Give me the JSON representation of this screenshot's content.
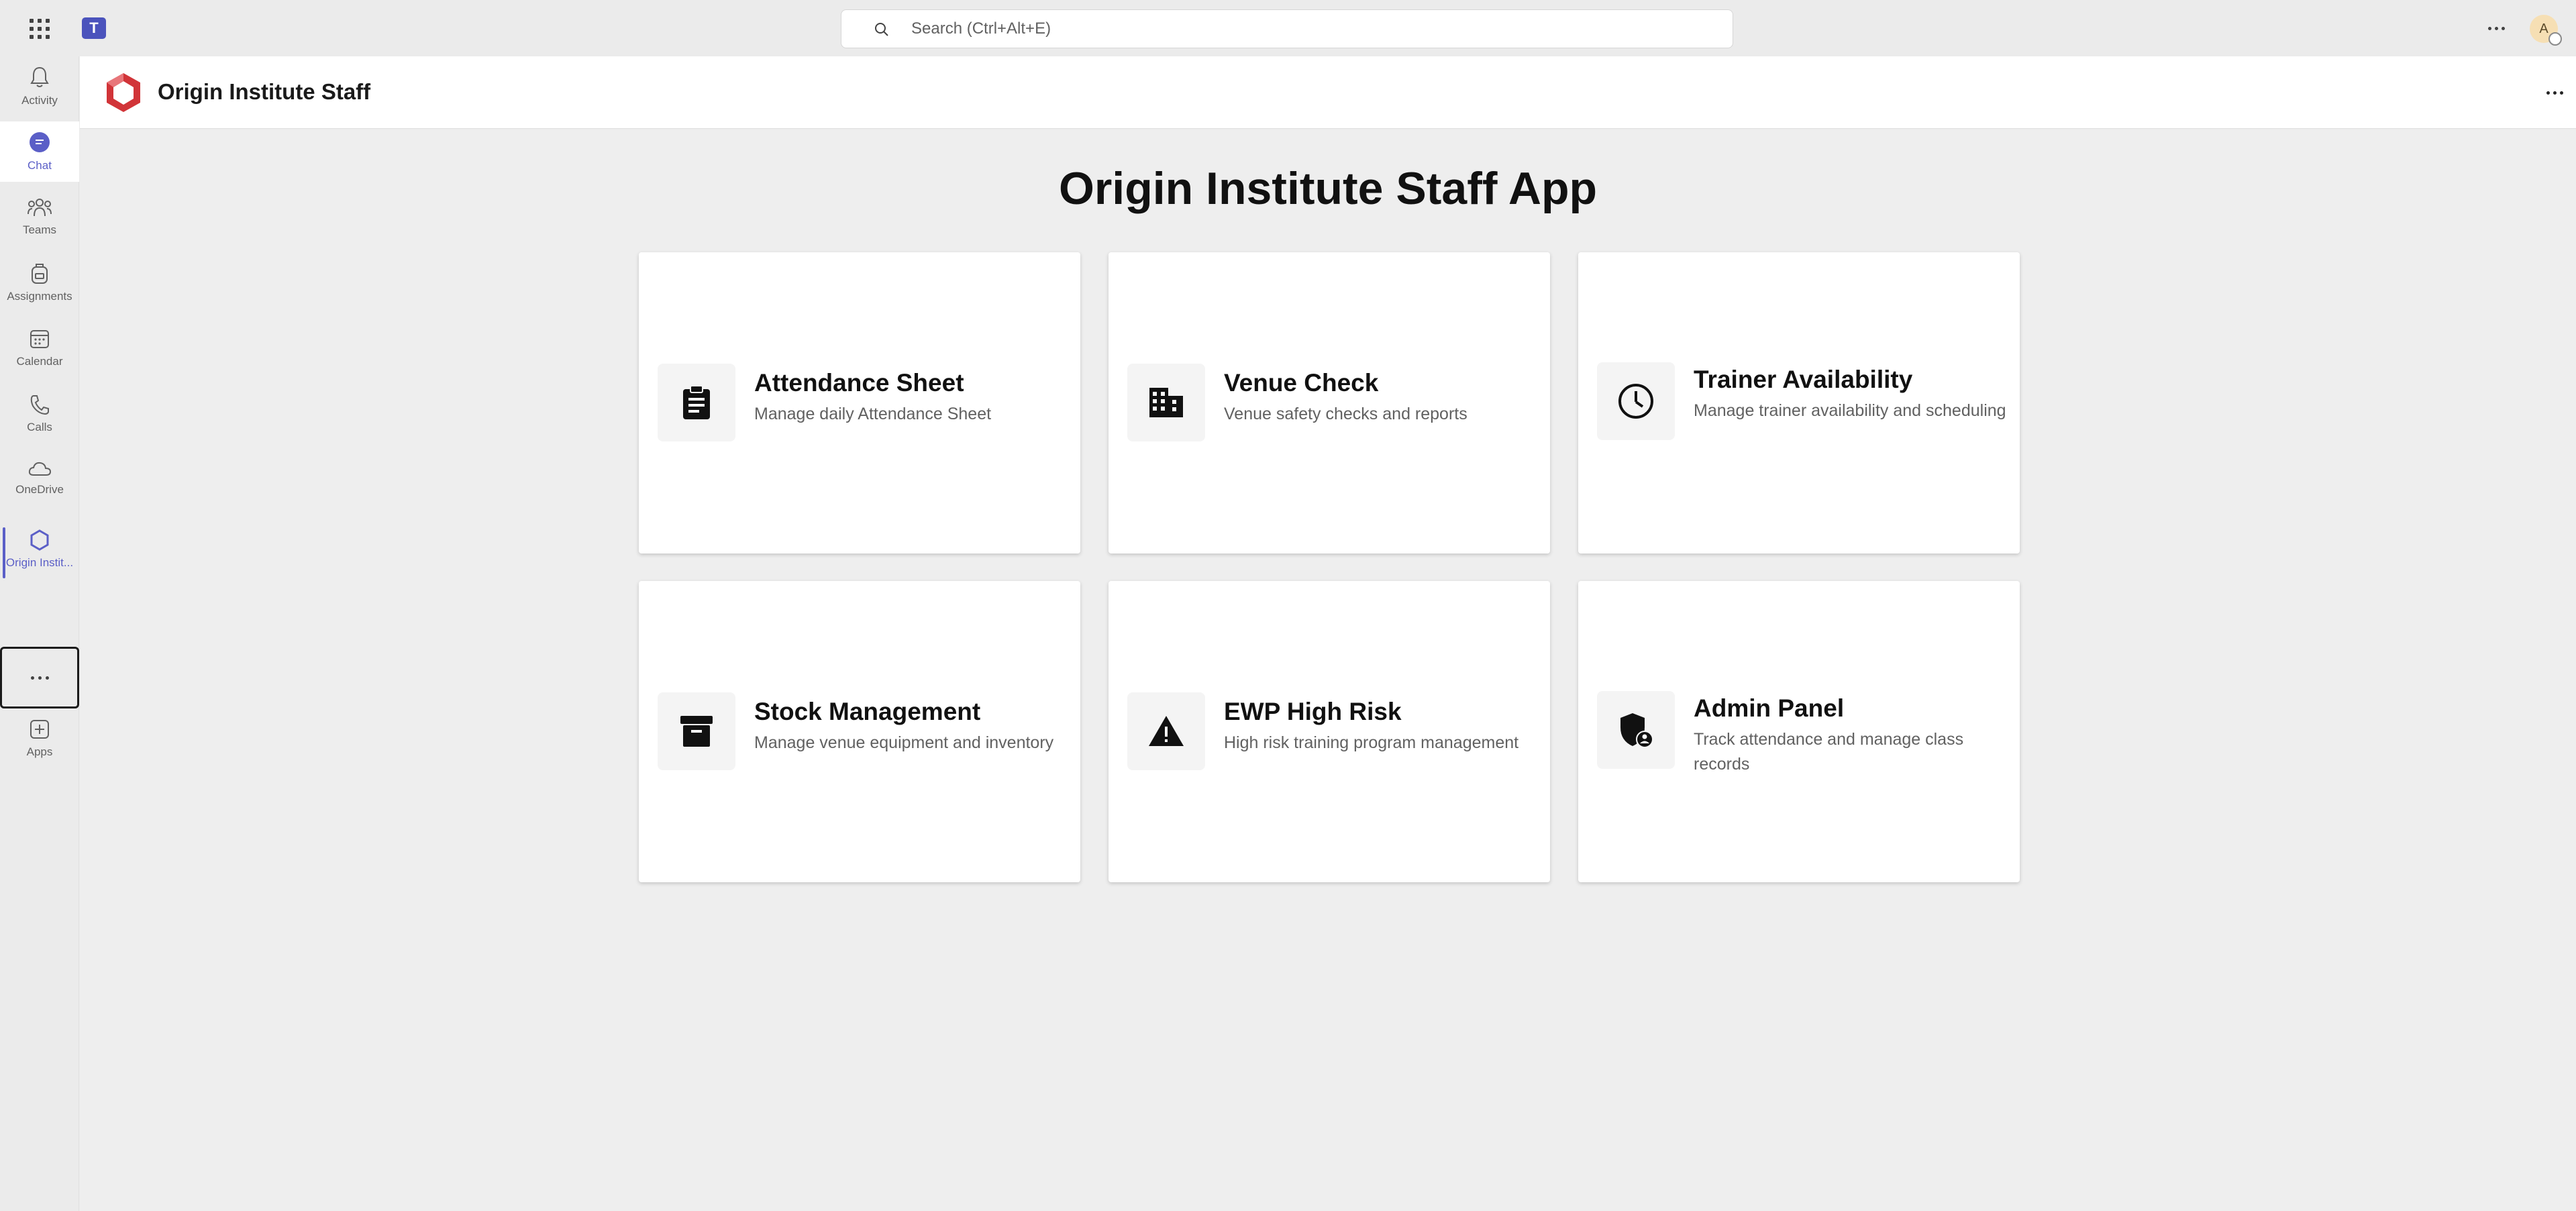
{
  "topbar": {
    "teams_logo": "T",
    "search_placeholder": "Search (Ctrl+Alt+E)",
    "avatar_initial": "A"
  },
  "rail": {
    "items": [
      {
        "label": "Activity",
        "icon": "bell-icon"
      },
      {
        "label": "Chat",
        "icon": "chat-icon"
      },
      {
        "label": "Teams",
        "icon": "teams-icon"
      },
      {
        "label": "Assignments",
        "icon": "backpack-icon"
      },
      {
        "label": "Calendar",
        "icon": "calendar-icon"
      },
      {
        "label": "Calls",
        "icon": "phone-icon"
      },
      {
        "label": "OneDrive",
        "icon": "cloud-icon"
      },
      {
        "label": "Origin Instit...",
        "icon": "origin-app-icon"
      },
      {
        "label": "Apps",
        "icon": "add-app-icon"
      }
    ]
  },
  "header": {
    "app_name": "Origin Institute Staff"
  },
  "main": {
    "title": "Origin Institute Staff App",
    "cards": [
      {
        "title": "Attendance Sheet",
        "description": "Manage daily Attendance Sheet",
        "icon": "clipboard-icon"
      },
      {
        "title": "Venue Check",
        "description": "Venue safety checks and reports",
        "icon": "building-icon"
      },
      {
        "title": "Trainer Availability",
        "description": "Manage trainer availability and scheduling",
        "icon": "clock-icon"
      },
      {
        "title": "Stock Management",
        "description": "Manage venue equipment and inventory",
        "icon": "archive-box-icon"
      },
      {
        "title": "EWP High Risk",
        "description": "High risk training program management",
        "icon": "warning-icon"
      },
      {
        "title": "Admin Panel",
        "description": "Track attendance and manage class records",
        "icon": "admin-shield-icon"
      }
    ]
  },
  "colors": {
    "accent": "#5b5fc7",
    "teams_brand": "#4b53bc",
    "app_logo": "#d13438"
  }
}
